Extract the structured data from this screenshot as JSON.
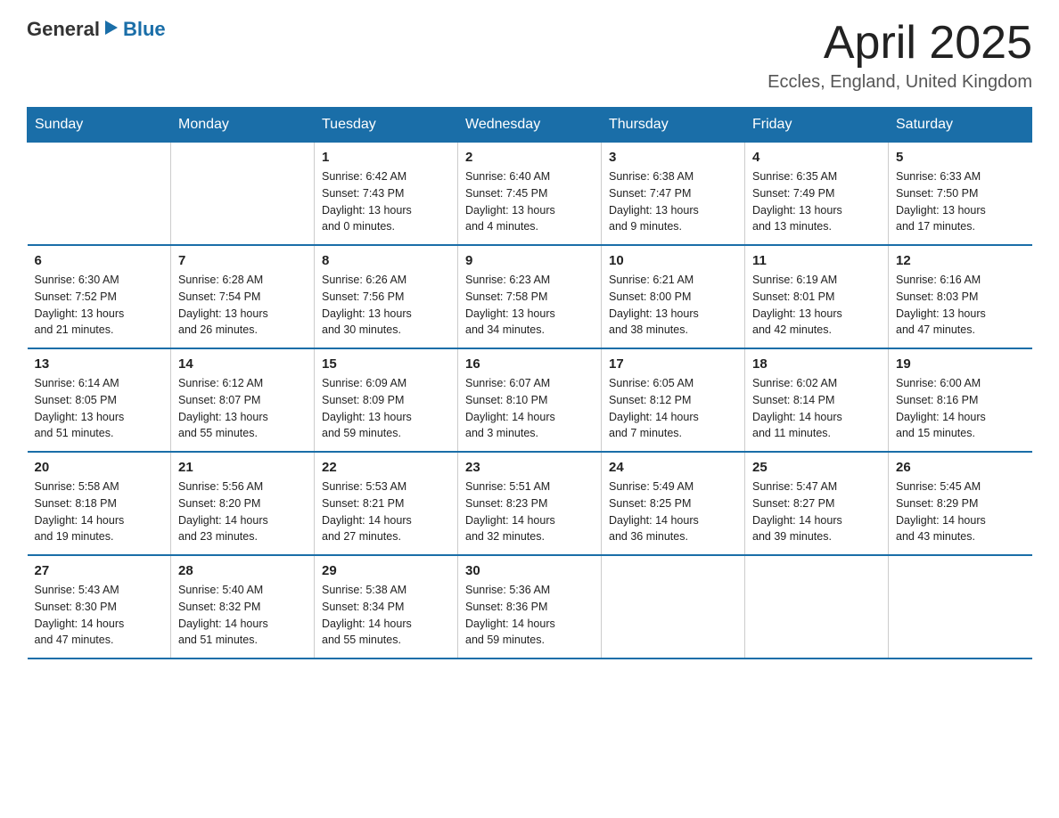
{
  "header": {
    "logo_general": "General",
    "logo_blue": "Blue",
    "title": "April 2025",
    "subtitle": "Eccles, England, United Kingdom"
  },
  "weekdays": [
    "Sunday",
    "Monday",
    "Tuesday",
    "Wednesday",
    "Thursday",
    "Friday",
    "Saturday"
  ],
  "weeks": [
    [
      {
        "day": "",
        "info": ""
      },
      {
        "day": "",
        "info": ""
      },
      {
        "day": "1",
        "info": "Sunrise: 6:42 AM\nSunset: 7:43 PM\nDaylight: 13 hours\nand 0 minutes."
      },
      {
        "day": "2",
        "info": "Sunrise: 6:40 AM\nSunset: 7:45 PM\nDaylight: 13 hours\nand 4 minutes."
      },
      {
        "day": "3",
        "info": "Sunrise: 6:38 AM\nSunset: 7:47 PM\nDaylight: 13 hours\nand 9 minutes."
      },
      {
        "day": "4",
        "info": "Sunrise: 6:35 AM\nSunset: 7:49 PM\nDaylight: 13 hours\nand 13 minutes."
      },
      {
        "day": "5",
        "info": "Sunrise: 6:33 AM\nSunset: 7:50 PM\nDaylight: 13 hours\nand 17 minutes."
      }
    ],
    [
      {
        "day": "6",
        "info": "Sunrise: 6:30 AM\nSunset: 7:52 PM\nDaylight: 13 hours\nand 21 minutes."
      },
      {
        "day": "7",
        "info": "Sunrise: 6:28 AM\nSunset: 7:54 PM\nDaylight: 13 hours\nand 26 minutes."
      },
      {
        "day": "8",
        "info": "Sunrise: 6:26 AM\nSunset: 7:56 PM\nDaylight: 13 hours\nand 30 minutes."
      },
      {
        "day": "9",
        "info": "Sunrise: 6:23 AM\nSunset: 7:58 PM\nDaylight: 13 hours\nand 34 minutes."
      },
      {
        "day": "10",
        "info": "Sunrise: 6:21 AM\nSunset: 8:00 PM\nDaylight: 13 hours\nand 38 minutes."
      },
      {
        "day": "11",
        "info": "Sunrise: 6:19 AM\nSunset: 8:01 PM\nDaylight: 13 hours\nand 42 minutes."
      },
      {
        "day": "12",
        "info": "Sunrise: 6:16 AM\nSunset: 8:03 PM\nDaylight: 13 hours\nand 47 minutes."
      }
    ],
    [
      {
        "day": "13",
        "info": "Sunrise: 6:14 AM\nSunset: 8:05 PM\nDaylight: 13 hours\nand 51 minutes."
      },
      {
        "day": "14",
        "info": "Sunrise: 6:12 AM\nSunset: 8:07 PM\nDaylight: 13 hours\nand 55 minutes."
      },
      {
        "day": "15",
        "info": "Sunrise: 6:09 AM\nSunset: 8:09 PM\nDaylight: 13 hours\nand 59 minutes."
      },
      {
        "day": "16",
        "info": "Sunrise: 6:07 AM\nSunset: 8:10 PM\nDaylight: 14 hours\nand 3 minutes."
      },
      {
        "day": "17",
        "info": "Sunrise: 6:05 AM\nSunset: 8:12 PM\nDaylight: 14 hours\nand 7 minutes."
      },
      {
        "day": "18",
        "info": "Sunrise: 6:02 AM\nSunset: 8:14 PM\nDaylight: 14 hours\nand 11 minutes."
      },
      {
        "day": "19",
        "info": "Sunrise: 6:00 AM\nSunset: 8:16 PM\nDaylight: 14 hours\nand 15 minutes."
      }
    ],
    [
      {
        "day": "20",
        "info": "Sunrise: 5:58 AM\nSunset: 8:18 PM\nDaylight: 14 hours\nand 19 minutes."
      },
      {
        "day": "21",
        "info": "Sunrise: 5:56 AM\nSunset: 8:20 PM\nDaylight: 14 hours\nand 23 minutes."
      },
      {
        "day": "22",
        "info": "Sunrise: 5:53 AM\nSunset: 8:21 PM\nDaylight: 14 hours\nand 27 minutes."
      },
      {
        "day": "23",
        "info": "Sunrise: 5:51 AM\nSunset: 8:23 PM\nDaylight: 14 hours\nand 32 minutes."
      },
      {
        "day": "24",
        "info": "Sunrise: 5:49 AM\nSunset: 8:25 PM\nDaylight: 14 hours\nand 36 minutes."
      },
      {
        "day": "25",
        "info": "Sunrise: 5:47 AM\nSunset: 8:27 PM\nDaylight: 14 hours\nand 39 minutes."
      },
      {
        "day": "26",
        "info": "Sunrise: 5:45 AM\nSunset: 8:29 PM\nDaylight: 14 hours\nand 43 minutes."
      }
    ],
    [
      {
        "day": "27",
        "info": "Sunrise: 5:43 AM\nSunset: 8:30 PM\nDaylight: 14 hours\nand 47 minutes."
      },
      {
        "day": "28",
        "info": "Sunrise: 5:40 AM\nSunset: 8:32 PM\nDaylight: 14 hours\nand 51 minutes."
      },
      {
        "day": "29",
        "info": "Sunrise: 5:38 AM\nSunset: 8:34 PM\nDaylight: 14 hours\nand 55 minutes."
      },
      {
        "day": "30",
        "info": "Sunrise: 5:36 AM\nSunset: 8:36 PM\nDaylight: 14 hours\nand 59 minutes."
      },
      {
        "day": "",
        "info": ""
      },
      {
        "day": "",
        "info": ""
      },
      {
        "day": "",
        "info": ""
      }
    ]
  ]
}
